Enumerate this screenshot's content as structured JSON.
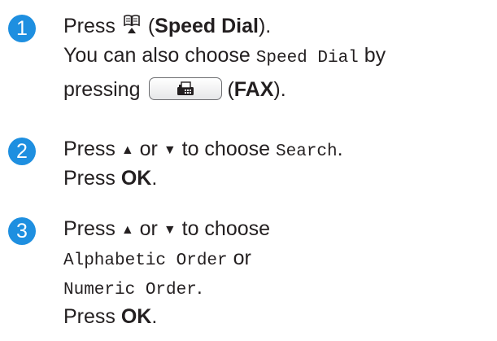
{
  "steps": [
    {
      "number": "1",
      "line1": {
        "press": "Press",
        "paren_open": "(",
        "bold": "Speed Dial",
        "paren_close": ")."
      },
      "line2": {
        "text": "You can also choose",
        "mono": "Speed Dial",
        "tail": "by"
      },
      "line3": {
        "text": "pressing",
        "paren_open": "(",
        "bold": "FAX",
        "paren_close": ")."
      }
    },
    {
      "number": "2",
      "line1": {
        "press": "Press",
        "up": "▲",
        "or": "or",
        "down": "▼",
        "text": "to choose",
        "mono": "Search",
        "end": "."
      },
      "line2": {
        "press": "Press",
        "bold": "OK",
        "end": "."
      }
    },
    {
      "number": "3",
      "line1": {
        "press": "Press",
        "up": "▲",
        "or": "or",
        "down": "▼",
        "text": "to choose"
      },
      "line2": {
        "mono": "Alphabetic Order",
        "or": "or"
      },
      "line3": {
        "mono": "Numeric Order",
        "end": "."
      },
      "line4": {
        "press": "Press",
        "bold": "OK",
        "end": "."
      }
    }
  ],
  "icons": {
    "speed_dial": "book-with-up-arrow-icon",
    "fax_key": "fax-machine-icon"
  },
  "colors": {
    "badge": "#1e8fe0",
    "text": "#231f20"
  }
}
